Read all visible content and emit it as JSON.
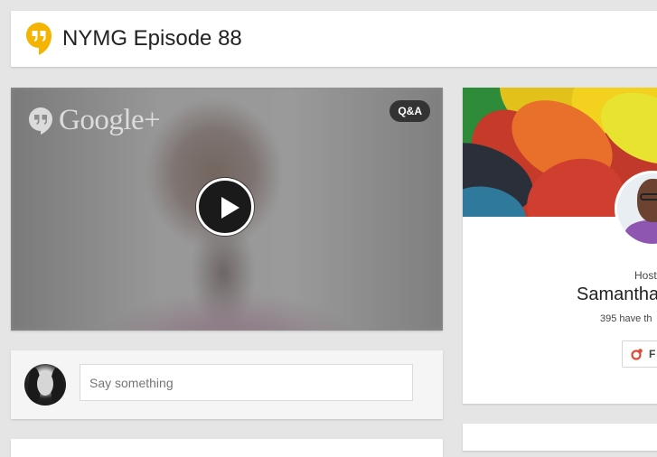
{
  "header": {
    "title": "NYMG Episode 88",
    "logo_icon": "hangouts-icon",
    "logo_color": "#f4b400"
  },
  "video": {
    "brand_text": "Google+",
    "brand_icon": "hangouts-quote-icon",
    "badge": "Q&A",
    "play_icon": "play-icon"
  },
  "comment": {
    "placeholder": "Say something"
  },
  "host": {
    "label": "Host",
    "name": "Samantha",
    "stat": "395 have th",
    "follow_label": "F",
    "follow_icon": "circles-icon",
    "follow_icon_color": "#dd4b39"
  }
}
